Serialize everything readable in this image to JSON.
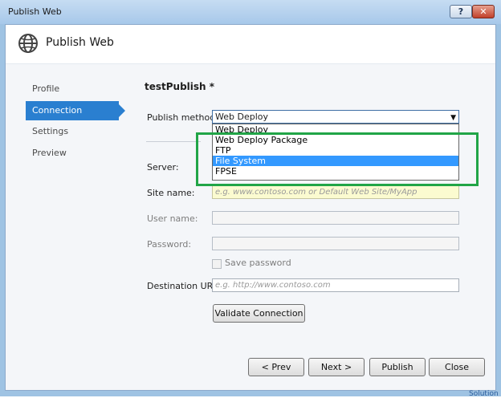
{
  "window": {
    "title": "Publish Web",
    "help_label": "?",
    "close_label": "✕"
  },
  "header": {
    "title": "Publish Web",
    "icon": "globe-icon"
  },
  "nav": {
    "items": [
      {
        "label": "Profile",
        "active": false
      },
      {
        "label": "Connection",
        "active": true
      },
      {
        "label": "Settings",
        "active": false
      },
      {
        "label": "Preview",
        "active": false
      }
    ]
  },
  "form": {
    "profile_name": "testPublish *",
    "publish_method_label": "Publish method:",
    "publish_method_value": "Web Deploy",
    "publish_method_options": [
      "Web Deploy",
      "Web Deploy Package",
      "FTP",
      "File System",
      "FPSE"
    ],
    "highlighted_option": "File System",
    "server_label": "Server:",
    "site_name_label": "Site name:",
    "site_name_placeholder": "e.g. www.contoso.com or Default Web Site/MyApp",
    "username_label": "User name:",
    "password_label": "Password:",
    "save_password_label": "Save password",
    "destination_url_label": "Destination URL:",
    "destination_url_placeholder": "e.g. http://www.contoso.com",
    "validate_button": "Validate Connection"
  },
  "footer": {
    "prev": "< Prev",
    "next": "Next >",
    "publish": "Publish",
    "close": "Close"
  },
  "outside": {
    "status_text": "Solution"
  },
  "colors": {
    "accent": "#2a7fd0",
    "dropdown_selection": "#3399ff",
    "annotation_box": "#21a547"
  }
}
